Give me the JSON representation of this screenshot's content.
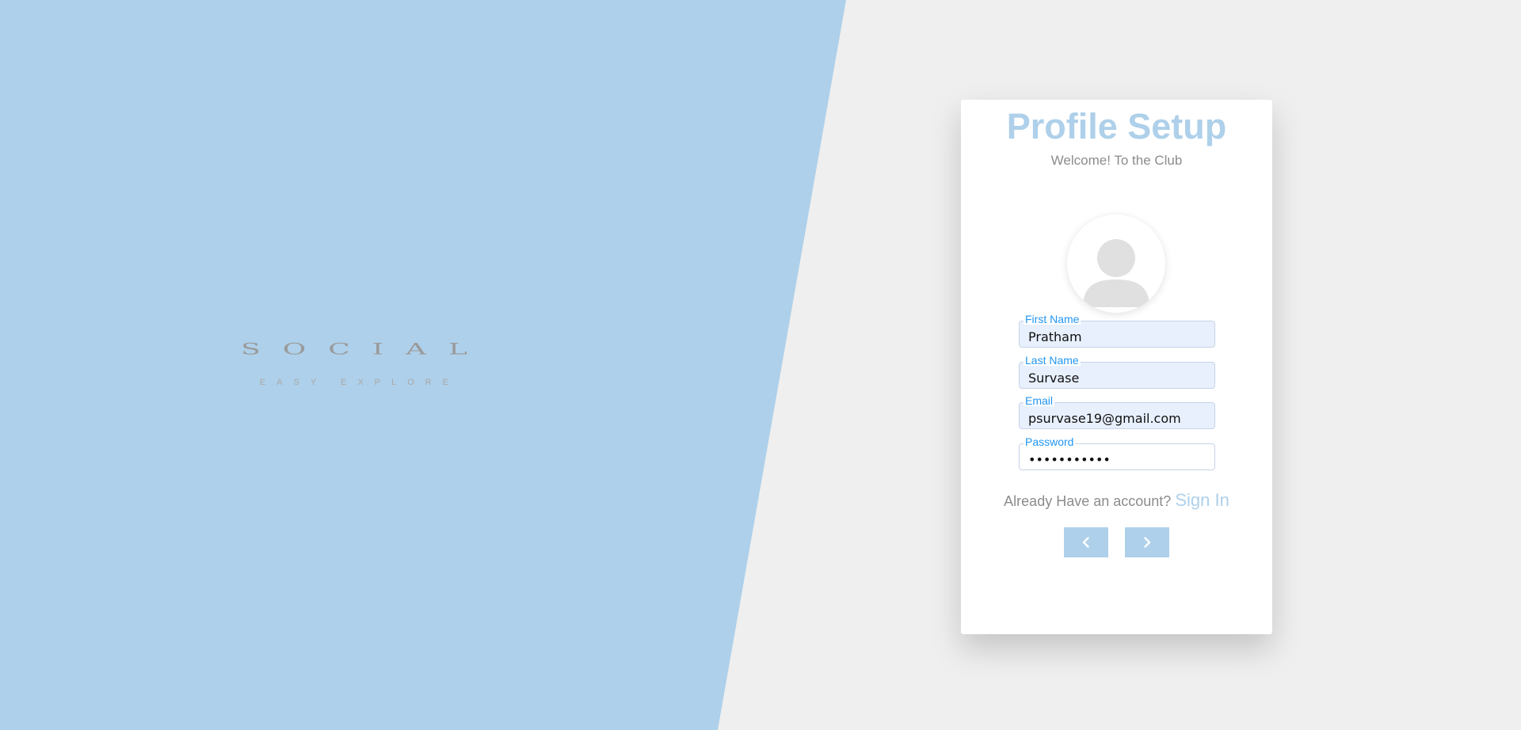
{
  "brand": {
    "logo_text": "SOCIAL",
    "tagline": "EASY EXPLORE"
  },
  "card": {
    "title": "Profile Setup",
    "subtitle": "Welcome! To the Club"
  },
  "avatar": {
    "icon": "user-placeholder-icon"
  },
  "form": {
    "first_name": {
      "label": "First Name",
      "value": "Pratham"
    },
    "last_name": {
      "label": "Last Name",
      "value": "Survase"
    },
    "email": {
      "label": "Email",
      "value": "psurvase19@gmail.com"
    },
    "password": {
      "label": "Password",
      "value": "•••••••••••"
    }
  },
  "signin": {
    "prompt": "Already Have an account?",
    "link_label": "Sign In"
  },
  "nav": {
    "prev_icon": "chevron-left-icon",
    "next_icon": "chevron-right-icon"
  },
  "colors": {
    "accent": "#aed0ea",
    "label": "#2196f3",
    "background": "#efefef",
    "muted_text": "#8c8c8c"
  }
}
